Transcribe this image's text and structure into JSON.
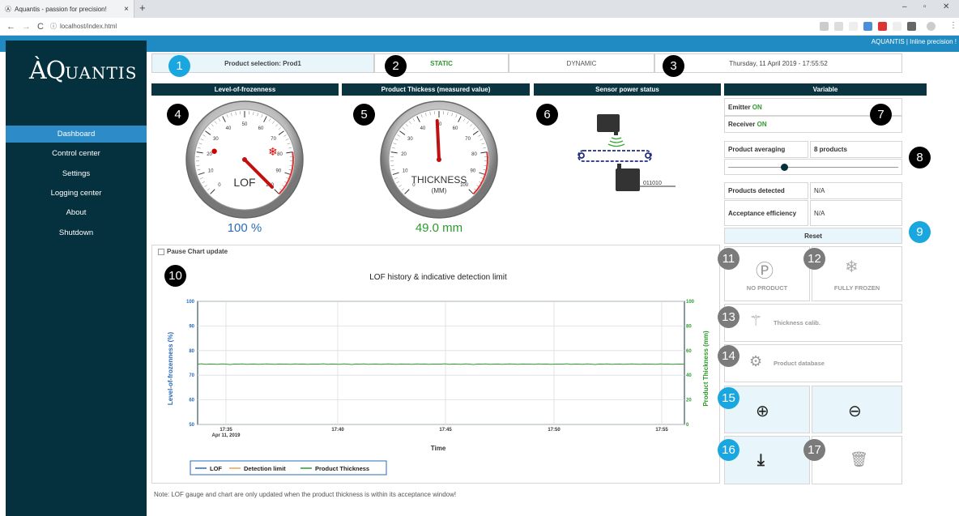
{
  "browser": {
    "tab_title": "Aquantis - passion for precision!",
    "url": "localhost/index.html",
    "new_tab": "+",
    "close": "×"
  },
  "banner": {
    "brand": "AQUANTIS | Inline precision !"
  },
  "sidebar": {
    "logo_main": "ÀQ",
    "logo_rest": "UANTIS",
    "items": [
      {
        "label": "Dashboard",
        "active": true
      },
      {
        "label": "Control center"
      },
      {
        "label": "Settings"
      },
      {
        "label": "Logging center"
      },
      {
        "label": "About"
      },
      {
        "label": "Shutdown"
      }
    ]
  },
  "top": {
    "product_selection": "Product selection: Prod1",
    "static": "STATIC",
    "dynamic": "DYNAMIC",
    "datetime": "Thursday, 11 April 2019 - 17:55:52"
  },
  "panels": {
    "lof_header": "Level-of-frozenness",
    "thickness_header": "Product Thickess (measured value)",
    "sensor_header": "Sensor power status",
    "variable_header": "Variable"
  },
  "lof_gauge": {
    "label": "LOF",
    "value": "100 %",
    "needle_fraction": 1.0,
    "ticks": [
      "0",
      "10",
      "20",
      "30",
      "40",
      "50",
      "60",
      "70",
      "80",
      "90",
      "100"
    ]
  },
  "thickness_gauge": {
    "label": "THICKNESS",
    "unit": "(MM)",
    "value": "49.0 mm",
    "needle_fraction": 0.49,
    "ticks": [
      "0",
      "10",
      "20",
      "30",
      "40",
      "50",
      "60",
      "70",
      "80",
      "90",
      "100"
    ]
  },
  "sensor": {
    "data_text": "011010"
  },
  "variables": {
    "emitter_label": "Emitter",
    "emitter_state": "ON",
    "receiver_label": "Receiver",
    "receiver_state": "ON",
    "averaging_label": "Product averaging",
    "averaging_value": "8 products",
    "slider_fraction": 0.33,
    "detected_label": "Products detected",
    "detected_value": "N/A",
    "acceptance_label": "Acceptance efficiency",
    "acceptance_value": "N/A",
    "reset_label": "Reset"
  },
  "chart_controls": {
    "pause_label": "Pause Chart update"
  },
  "actions": {
    "no_product": "NO PRODUCT",
    "fully_frozen": "FULLY FROZEN",
    "thickness_calib": "Thickness calib.",
    "product_database": "Product database"
  },
  "note": "Note: LOF gauge and chart are only updated when the product thickness is within its acceptance window!",
  "badges": [
    "1",
    "2",
    "3",
    "4",
    "5",
    "6",
    "7",
    "8",
    "9",
    "10",
    "11",
    "12",
    "13",
    "14",
    "15",
    "16",
    "17"
  ],
  "colors": {
    "sidebar": "#05303d",
    "accent_blue": "#1f8bc2",
    "lof": "#2b6cb8",
    "thickness": "#2d9a2d"
  },
  "chart_data": {
    "type": "line",
    "title": "LOF history & indicative detection limit",
    "xlabel": "Time",
    "ylabel": "Level-of-frozenness (%)",
    "y2label": "Product Thickness (mm)",
    "x_ticks": [
      "17:35",
      "17:40",
      "17:45",
      "17:50",
      "17:55"
    ],
    "x_first_date": "Apr 11, 2019",
    "ylim": [
      50,
      100
    ],
    "y_ticks": [
      "50",
      "60",
      "70",
      "80",
      "90",
      "100"
    ],
    "y2lim": [
      0,
      100
    ],
    "y2_ticks": [
      "0",
      "20",
      "40",
      "60",
      "80",
      "100"
    ],
    "legend": [
      "LOF",
      "Detection limit",
      "Product Thickness"
    ],
    "legend_position": "bottom-left",
    "series": [
      {
        "name": "LOF",
        "values": []
      },
      {
        "name": "Detection limit",
        "values": []
      },
      {
        "name": "Product Thickness",
        "approx_constant": 49,
        "values": [
          49,
          49.3,
          48.8,
          49.1,
          49,
          48.9,
          49.2,
          49,
          48.7,
          49.1,
          49,
          49.2,
          48.9,
          49,
          49.1,
          48.8,
          49,
          49.2,
          49,
          48.9,
          49.1,
          49,
          49,
          48.8,
          49.2,
          49,
          49.1,
          48.9,
          49,
          49
        ]
      }
    ]
  }
}
